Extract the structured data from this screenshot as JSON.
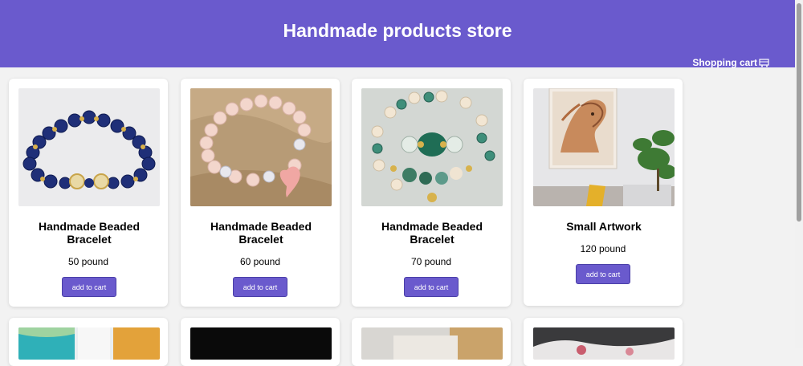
{
  "header": {
    "title": "Handmade products store",
    "cart_label": "Shopping cart",
    "cart_icon": "shopping-cart-icon",
    "background_color": "#6a5acd"
  },
  "products": [
    {
      "name": "Handmade Beaded Bracelet",
      "price": "50 pound",
      "button_label": "add to cart",
      "image": "blue-beaded-bracelet"
    },
    {
      "name": "Handmade Beaded Bracelet",
      "price": "60 pound",
      "button_label": "add to cart",
      "image": "pink-beaded-bracelet"
    },
    {
      "name": "Handmade Beaded Bracelet",
      "price": "70 pound",
      "button_label": "add to cart",
      "image": "green-beaded-bracelets"
    },
    {
      "name": "Small Artwork",
      "price": "120 pound",
      "button_label": "add to cart",
      "image": "horse-painting"
    }
  ],
  "colors": {
    "accent": "#6a5acd",
    "page_background": "#f2f2f2"
  }
}
